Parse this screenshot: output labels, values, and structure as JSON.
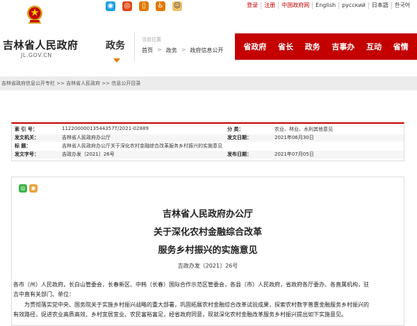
{
  "top_links": {
    "login": "登录",
    "register": "注册",
    "china_gov": "中国政府网",
    "english": "English",
    "russian": "русский",
    "japanese": "日本語",
    "korean": "한국어"
  },
  "site": {
    "name": "吉林省人民政府",
    "domain": "JL.GOV.CN"
  },
  "section": {
    "label": "政务"
  },
  "location": {
    "label": "当前位置",
    "path": [
      "首页",
      "政务",
      "政府信息公开"
    ],
    "separator": ">"
  },
  "main_nav": [
    "省政府",
    "省长",
    "政务",
    "吉事办",
    "互动",
    "省情"
  ],
  "breadcrumb": "吉林省政府信息公开专栏 >> 吉林省人民政府 >> 信息公开目录",
  "info": {
    "index_label": "索 引 号：",
    "index_value": "11220000013544357T/2021-02889",
    "category_label": "分       类：",
    "category_value": "农业、林业、水利其他意见",
    "issuer_label": "发文机关：",
    "issuer_value": "吉林省人民政府办公厅",
    "date_label": "发文日期：",
    "date_value": "2021年06月30日",
    "title_label": "标       题：",
    "title_value": "吉林省人民政府办公厅关于深化农村金融综合改革服务乡村振兴的实施意见",
    "docno_label": "发文字号：",
    "docno_value": "吉政办发〔2021〕26号",
    "publish_label": "发布日期：",
    "publish_value": "2021年07月05日"
  },
  "doc": {
    "title1": "吉林省人民政府办公厅",
    "title2": "关于深化农村金融综合改革",
    "title3": "服务乡村振兴的实施意见",
    "number": "吉政办发〔2021〕26号",
    "para1_line1": "各市（州）人民政府，长白山管委会，长春新区、中韩（长春）国际合作示范区管委会，各县（市）人民政府，省政府各厅委办、各直属机构，驻",
    "para1_line2": "吉中直有关部门、单位：",
    "para2_line1": "为贯彻落实党中央、国务院关于实施乡村振兴战略的重大部署，巩固拓展农村金融综合改革试验成果，探索农村数字普惠金融服务乡村振兴的",
    "para2_line2": "有效路径，促进农业高质高效、乡村宜居宜业、农民富裕富足，经省政府同意，现就深化农村金融改革服务乡村振兴提出如下实施意见。"
  },
  "colors": {
    "brand_red": "#c40000",
    "accent_orange": "#e07b00"
  }
}
